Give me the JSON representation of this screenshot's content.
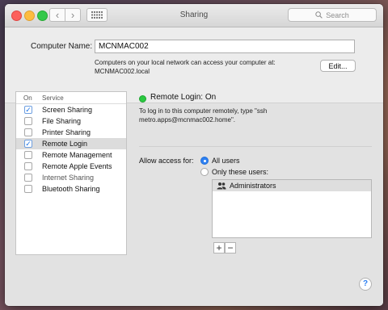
{
  "window": {
    "title": "Sharing"
  },
  "toolbar": {
    "back_glyph": "‹",
    "forward_glyph": "›",
    "search_placeholder": "Search",
    "search_icon": "magnifier-icon"
  },
  "computer_name": {
    "label": "Computer Name:",
    "value": "MCNMAC002",
    "description_line1": "Computers on your local network can access your computer at:",
    "description_line2": "MCNMAC002.local",
    "edit_label": "Edit..."
  },
  "services": {
    "header_on": "On",
    "header_service": "Service",
    "items": [
      {
        "name": "Screen Sharing",
        "checked": true,
        "selected": false,
        "enabled": true
      },
      {
        "name": "File Sharing",
        "checked": false,
        "selected": false,
        "enabled": true
      },
      {
        "name": "Printer Sharing",
        "checked": false,
        "selected": false,
        "enabled": true
      },
      {
        "name": "Remote Login",
        "checked": true,
        "selected": true,
        "enabled": true
      },
      {
        "name": "Remote Management",
        "checked": false,
        "selected": false,
        "enabled": true
      },
      {
        "name": "Remote Apple Events",
        "checked": false,
        "selected": false,
        "enabled": true
      },
      {
        "name": "Internet Sharing",
        "checked": false,
        "selected": false,
        "enabled": false
      },
      {
        "name": "Bluetooth Sharing",
        "checked": false,
        "selected": false,
        "enabled": true
      }
    ]
  },
  "detail": {
    "status": "Remote Login: On",
    "status_color": "#2ac940",
    "description_line1": "To log in to this computer remotely, type \"ssh",
    "description_line2": "metro.apps@mcnmac002.home\".",
    "allow_label": "Allow access for:",
    "option_all": "All users",
    "option_only": "Only these users:",
    "selected_option": "all",
    "users": [
      "Administrators"
    ],
    "add_label": "+",
    "remove_label": "−"
  },
  "help": {
    "label": "?"
  },
  "colors": {
    "accent": "#2d80f2",
    "window_bg": "#ececec"
  }
}
